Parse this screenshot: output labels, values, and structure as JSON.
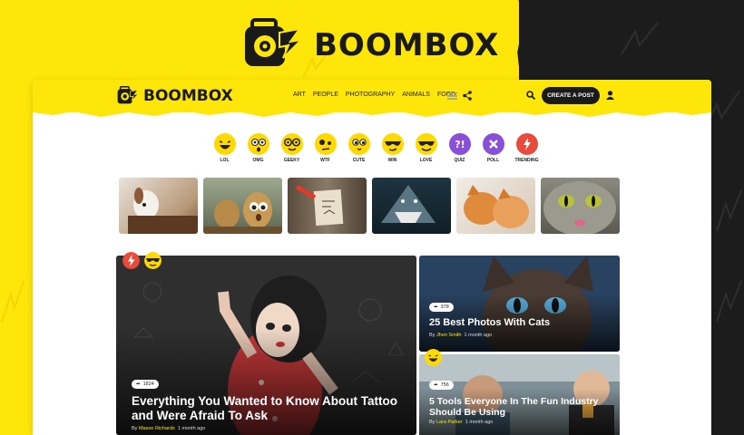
{
  "brand": {
    "name": "BOOMBOX",
    "accent": "#ffe60a",
    "dark": "#1c1c1c"
  },
  "nav": {
    "logo_text": "BOOMBOX",
    "menu": [
      "ART",
      "PEOPLE",
      "PHOTOGRAPHY",
      "ANIMALS",
      "FOOD"
    ],
    "menu_icon": "hamburger-icon",
    "share_icon": "share-icon",
    "search_icon": "search-icon",
    "create_post": "CREATE A POST",
    "user_icon": "user-icon"
  },
  "reactions": [
    {
      "label": "LOL",
      "color": "#ffd900"
    },
    {
      "label": "OMG",
      "color": "#ffd900"
    },
    {
      "label": "GEEKY",
      "color": "#ffd900"
    },
    {
      "label": "WTF",
      "color": "#ffd900"
    },
    {
      "label": "CUTE",
      "color": "#ffd900"
    },
    {
      "label": "WIN",
      "color": "#ffd900"
    },
    {
      "label": "LOVE",
      "color": "#ffd900"
    },
    {
      "label": "QUIZ",
      "color": "#8a4fd8"
    },
    {
      "label": "POLL",
      "color": "#8a4fd8"
    },
    {
      "label": "TRENDING",
      "color": "#e84a3c"
    }
  ],
  "thumbs": [
    {
      "name": "dog-photo"
    },
    {
      "name": "potatoes-photo"
    },
    {
      "name": "lost-cat-sign-photo"
    },
    {
      "name": "shark-illustration"
    },
    {
      "name": "cats-photo"
    },
    {
      "name": "cat-face-photo"
    }
  ],
  "posts": {
    "featured": {
      "shares": "1824",
      "title": "Everything You Wanted to Know About Tattoo and Were Afraid To Ask",
      "by": "By",
      "author": "Mason Richards",
      "time": "1 month ago"
    },
    "side1": {
      "shares": "378",
      "title": "25 Best Photos With Cats",
      "by": "By",
      "author": "Jhon Smith",
      "time": "1 month ago"
    },
    "side2": {
      "shares": "756",
      "title": "5 Tools Everyone In The Fun Industry Should Be Using",
      "by": "By",
      "author": "Lara Parker",
      "time": "1 month ago"
    }
  }
}
